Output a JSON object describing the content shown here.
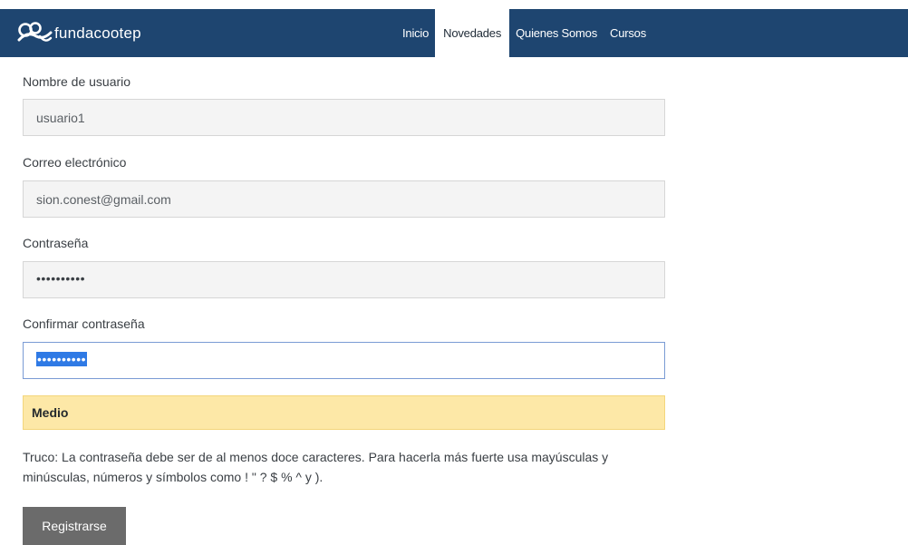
{
  "header": {
    "brand_name": "fundacootep",
    "nav": [
      {
        "label": "Inicio",
        "active": false
      },
      {
        "label": "Novedades",
        "active": true
      },
      {
        "label": "Quienes Somos",
        "active": false
      },
      {
        "label": "Cursos",
        "active": false
      }
    ],
    "background_color": "#1e4570"
  },
  "form": {
    "username": {
      "label": "Nombre de usuario",
      "value": "usuario1"
    },
    "email": {
      "label": "Correo electrónico",
      "value": "sion.conest@gmail.com"
    },
    "password": {
      "label": "Contraseña",
      "masked_value": "••••••••••"
    },
    "confirm_password": {
      "label": "Confirmar contraseña",
      "masked_value": "••••••••••",
      "focused": true,
      "text_selected": true
    },
    "strength": {
      "label": "Medio",
      "color": "#fde8a7"
    },
    "hint": "Truco: La contraseña debe ser de al menos doce caracteres. Para hacerla más fuerte usa mayúsculas y minúsculas, números y símbolos como ! \" ? $ % ^ y ).",
    "submit_label": "Registrarse"
  }
}
